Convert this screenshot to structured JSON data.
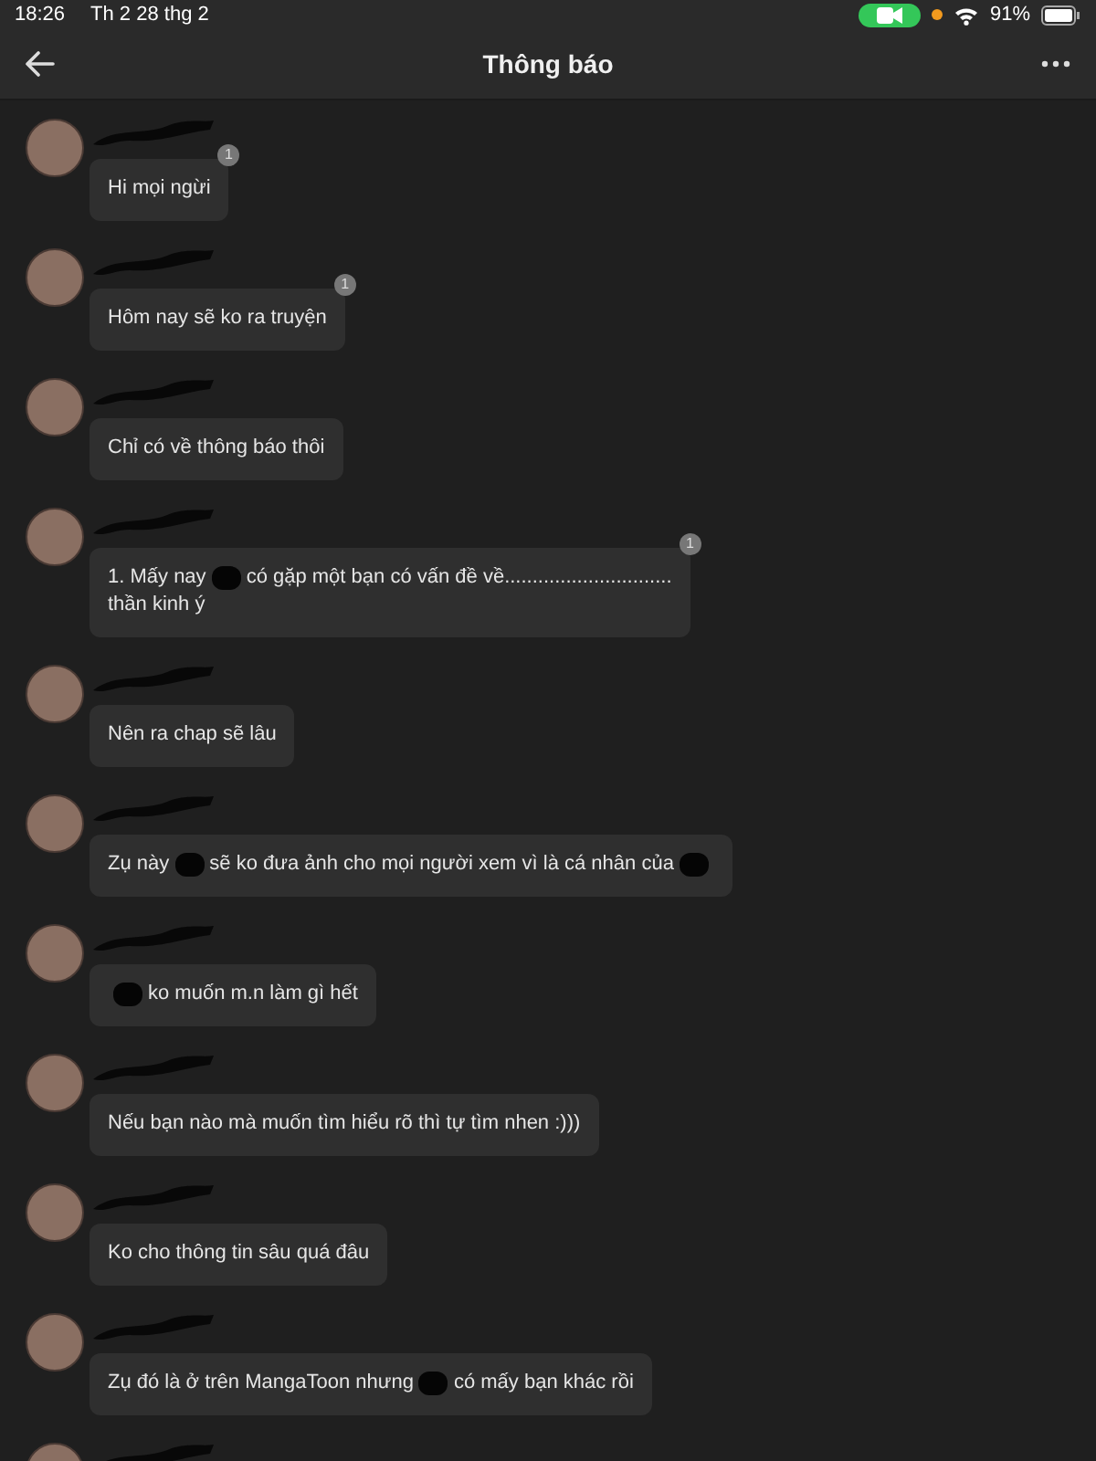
{
  "status_bar": {
    "time": "18:26",
    "date": "Th 2 28 thg 2",
    "battery": "91%"
  },
  "header": {
    "title": "Thông báo"
  },
  "messages": [
    {
      "lines": [
        [
          "Hi mọi ngừi"
        ]
      ],
      "badge": "1"
    },
    {
      "lines": [
        [
          "Hôm nay sẽ ko ra truyện"
        ]
      ],
      "badge": "1"
    },
    {
      "lines": [
        [
          "Chỉ có về thông báo thôi"
        ]
      ]
    },
    {
      "lines": [
        [
          "1. Mấy nay",
          "có gặp một bạn có vấn đề về.............................."
        ],
        [
          "thần kinh ý"
        ]
      ],
      "badge": "1"
    },
    {
      "lines": [
        [
          "Nên ra chap sẽ lâu"
        ]
      ]
    },
    {
      "lines": [
        [
          "Zụ này",
          "sẽ ko đưa ảnh cho mọi người xem vì là cá nhân của"
        ]
      ],
      "redacted_end": true
    },
    {
      "lines": [
        [
          "ko muốn m.n làm gì hết"
        ]
      ],
      "redacted_start": true
    },
    {
      "lines": [
        [
          "Nếu bạn nào mà muốn tìm hiểu rõ thì tự tìm nhen :)))"
        ]
      ]
    },
    {
      "lines": [
        [
          "Ko cho thông tin sâu quá đâu"
        ]
      ]
    },
    {
      "lines": [
        [
          "Zụ đó là ở trên MangaToon nhưng",
          "có mấy bạn khác rồi"
        ]
      ]
    }
  ]
}
